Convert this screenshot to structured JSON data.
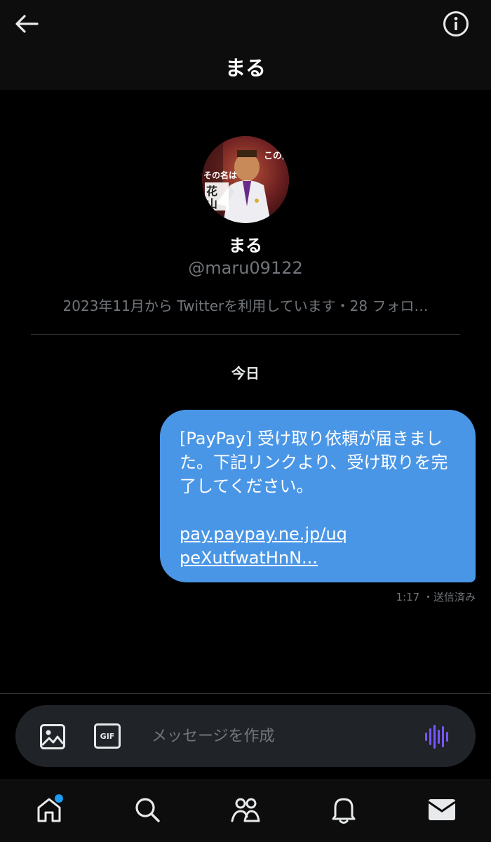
{
  "header": {
    "title": "まる",
    "back_icon": "arrow-left-icon",
    "info_icon": "info-icon"
  },
  "profile": {
    "name": "まる",
    "handle": "@maru09122",
    "meta": "2023年11月から Twitterを利用しています・28 フォロ…",
    "avatar_text": [
      "この男",
      "その名は",
      "花山"
    ]
  },
  "conversation": {
    "day_label": "今日",
    "messages": [
      {
        "text": "[PayPay] 受け取り依頼が届きました。下記リンクより、受け取りを完了してください。",
        "link": "pay.paypay.ne.jp/uqpeXutfwatHnN...",
        "time": "1:17",
        "status": "・送信済み"
      }
    ]
  },
  "composer": {
    "placeholder": "メッセージを作成",
    "image_icon": "image-icon",
    "gif_label": "GIF",
    "voice_icon": "voice-wave-icon"
  },
  "tabs": [
    {
      "name": "home",
      "icon": "home-icon",
      "badge": true
    },
    {
      "name": "search",
      "icon": "search-icon",
      "badge": false
    },
    {
      "name": "communities",
      "icon": "communities-icon",
      "badge": false
    },
    {
      "name": "notifications",
      "icon": "bell-icon",
      "badge": false
    },
    {
      "name": "messages",
      "icon": "mail-icon",
      "badge": false
    }
  ],
  "colors": {
    "background": "#000000",
    "bubble": "#4a96e6",
    "muted": "#71767b",
    "accent": "#1d9bf0",
    "voice": "#7856ff"
  }
}
